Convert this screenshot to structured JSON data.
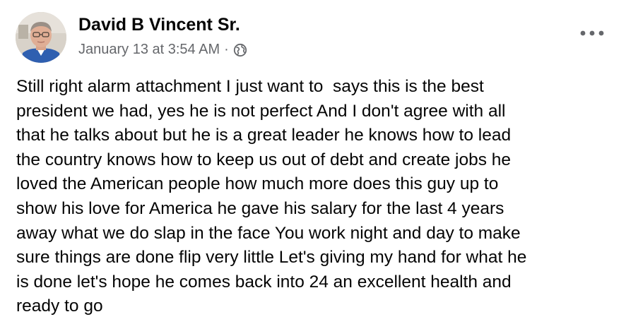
{
  "post": {
    "author": "David B Vincent Sr.",
    "timestamp": "January 13 at 3:54 AM",
    "separator": "·",
    "privacy_icon": "globe-icon",
    "more_icon": "more-options-icon",
    "lines": [
      "Still right alarm attachment I just want to  says this is the best",
      "president we had, yes he is not perfect And I don't agree with all",
      "that he talks about but he is a great leader he knows how to lead",
      "the country knows how to keep us out of debt and create jobs he",
      "loved the American people how much more does this guy up to",
      "show his love for America he gave his salary for the last 4 years",
      "away what we do slap in the face You work night and day to make",
      "sure things are done flip very little Let's giving my hand for what he",
      "is done let's hope he comes back into 24 an excellent health and",
      "ready to go"
    ]
  },
  "colors": {
    "text_primary": "#050505",
    "text_secondary": "#65676b",
    "background": "#ffffff"
  }
}
